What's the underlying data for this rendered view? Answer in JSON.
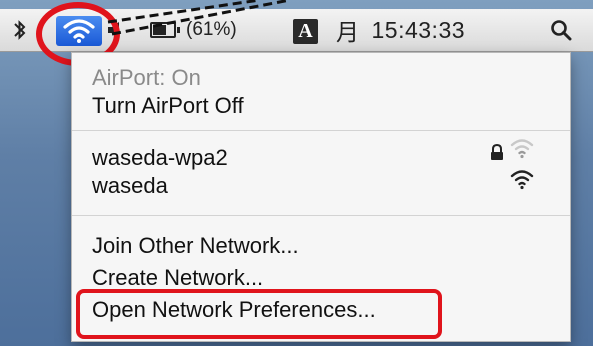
{
  "menubar": {
    "battery_text": "(61%)",
    "input_source": "A",
    "day": "月",
    "time": "15:43:33"
  },
  "airport_menu": {
    "status": "AirPort: On",
    "toggle_label": "Turn AirPort Off",
    "networks": [
      {
        "name": "waseda-wpa2",
        "locked": true,
        "signal": "weak"
      },
      {
        "name": "waseda",
        "locked": false,
        "signal": "strong"
      }
    ],
    "join_other_label": "Join Other Network...",
    "create_network_label": "Create Network...",
    "open_prefs_label": "Open Network Preferences..."
  },
  "colors": {
    "highlight": "#e0141c",
    "wifi_active_bg": "#1a59d6"
  },
  "icons": [
    "bluetooth-icon",
    "wifi-icon",
    "volume-icon",
    "battery-icon",
    "spotlight-icon",
    "lock-icon",
    "wifi-signal-icon"
  ]
}
